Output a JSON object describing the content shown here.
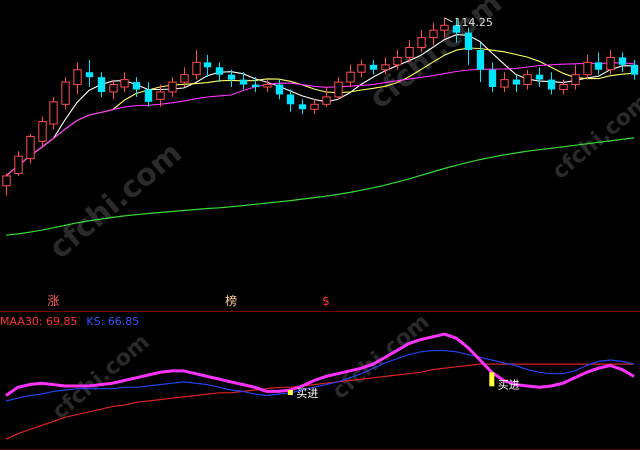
{
  "chart_data": [
    {
      "type": "candlestick",
      "title": "",
      "price_label": "114.25",
      "ylim": [
        20,
        118
      ],
      "colors": {
        "up": "#ff4d4d",
        "down": "#00e5ff",
        "ma_short": "#ffffff",
        "ma_mid": "#ffff66",
        "ma_long": "#ff33ff",
        "ma_xlong": "#33dd33"
      },
      "candles": [
        [
          46,
          50,
          42,
          51
        ],
        [
          51,
          58,
          50,
          60
        ],
        [
          57,
          66,
          55,
          67
        ],
        [
          64,
          72,
          62,
          74
        ],
        [
          71,
          80,
          69,
          82
        ],
        [
          79,
          88,
          77,
          90
        ],
        [
          87,
          93,
          83,
          96
        ],
        [
          92,
          90,
          86,
          97
        ],
        [
          90,
          84,
          82,
          92
        ],
        [
          84,
          87,
          81,
          89
        ],
        [
          86,
          89,
          84,
          92
        ],
        [
          88,
          85,
          82,
          90
        ],
        [
          85,
          80,
          78,
          88
        ],
        [
          81,
          84,
          78,
          87
        ],
        [
          84,
          88,
          82,
          90
        ],
        [
          88,
          91,
          86,
          94
        ],
        [
          91,
          96,
          89,
          101
        ],
        [
          96,
          94,
          90,
          99
        ],
        [
          94,
          91,
          88,
          96
        ],
        [
          91,
          89,
          86,
          93
        ],
        [
          89,
          87,
          85,
          92
        ],
        [
          87,
          86,
          84,
          90
        ],
        [
          86,
          87,
          84,
          89
        ],
        [
          87,
          83,
          81,
          89
        ],
        [
          83,
          79,
          76,
          85
        ],
        [
          79,
          77,
          75,
          81
        ],
        [
          77,
          79,
          75,
          81
        ],
        [
          79,
          82,
          78,
          86
        ],
        [
          82,
          88,
          81,
          90
        ],
        [
          88,
          92,
          86,
          95
        ],
        [
          92,
          95,
          90,
          97
        ],
        [
          95,
          93,
          91,
          97
        ],
        [
          93,
          95,
          91,
          98
        ],
        [
          95,
          98,
          93,
          101
        ],
        [
          98,
          102,
          96,
          105
        ],
        [
          102,
          106,
          100,
          109
        ],
        [
          106,
          109,
          103,
          112
        ],
        [
          109,
          111,
          106,
          114
        ],
        [
          111,
          108,
          104,
          114
        ],
        [
          108,
          101,
          95,
          110
        ],
        [
          101,
          93,
          88,
          104
        ],
        [
          93,
          86,
          84,
          96
        ],
        [
          86,
          89,
          84,
          92
        ],
        [
          89,
          87,
          84,
          91
        ],
        [
          87,
          91,
          85,
          93
        ],
        [
          91,
          89,
          86,
          94
        ],
        [
          89,
          85,
          83,
          92
        ],
        [
          85,
          87,
          83,
          89
        ],
        [
          87,
          91,
          85,
          95
        ],
        [
          91,
          96,
          89,
          99
        ],
        [
          96,
          93,
          91,
          100
        ],
        [
          93,
          98,
          91,
          101
        ],
        [
          98,
          95,
          92,
          100
        ],
        [
          95,
          91,
          89,
          97
        ]
      ],
      "sma": [
        {
          "name": "MA5",
          "period": 5,
          "color": "#ffffff"
        },
        {
          "name": "MA10",
          "period": 10,
          "color": "#ffff66"
        },
        {
          "name": "MA20",
          "period": 20,
          "color": "#ff33ff"
        }
      ],
      "long_ma": [
        26.0,
        26.5,
        27.2,
        28.0,
        29.0,
        30.0,
        31.0,
        31.8,
        32.5,
        33.2,
        33.8,
        34.3,
        34.8,
        35.2,
        35.6,
        36.0,
        36.4,
        36.8,
        37.1,
        37.5,
        38.0,
        38.5,
        39.0,
        39.5,
        40.0,
        40.6,
        41.2,
        41.8,
        42.5,
        43.3,
        44.2,
        45.2,
        46.3,
        47.5,
        48.8,
        50.2,
        51.6,
        53.0,
        54.3,
        55.5,
        56.6,
        57.6,
        58.5,
        59.3,
        60.0,
        60.6,
        61.2,
        61.8,
        62.4,
        63.0,
        63.6,
        64.2,
        64.8,
        65.4
      ],
      "markers": [
        {
          "index": 4,
          "text": "涨",
          "color": "#ff6666"
        },
        {
          "index": 19,
          "text": "榜",
          "color": "#ffcc99"
        },
        {
          "index": 27,
          "text": "$",
          "color": "#ff3333"
        }
      ]
    },
    {
      "type": "line",
      "legend": [
        {
          "text": "MAA30: 69.85",
          "color": "#ff3333"
        },
        {
          "text": "KS: 66.85",
          "color": "#3355ff"
        }
      ],
      "ylim": [
        25,
        110
      ],
      "series": [
        {
          "name": "MAA30",
          "color": "#dd2222",
          "values": [
            30,
            34,
            37,
            40,
            43,
            46,
            48,
            50,
            52,
            54,
            55,
            57,
            58,
            59,
            60,
            61,
            62,
            63,
            64,
            64,
            65,
            66,
            67,
            68,
            68,
            69,
            70,
            71,
            72,
            73,
            74,
            75,
            76,
            77,
            78,
            79,
            81,
            82,
            83,
            84,
            85,
            85,
            85,
            85,
            85,
            85,
            85,
            85,
            85,
            85,
            85,
            85,
            85,
            85
          ]
        },
        {
          "name": "KS",
          "color": "#2244ee",
          "values": [
            58,
            60,
            62,
            63,
            65,
            66,
            67,
            67,
            67,
            67,
            68,
            68,
            69,
            70,
            71,
            72,
            71,
            70,
            68,
            66,
            65,
            63,
            62,
            63,
            64,
            66,
            68,
            70,
            72,
            75,
            78,
            82,
            86,
            89,
            92,
            94,
            95,
            95,
            94,
            92,
            90,
            88,
            86,
            84,
            81,
            79,
            78,
            78,
            80,
            84,
            87,
            88,
            87,
            85
          ]
        },
        {
          "name": "",
          "color": "#ff33ff",
          "values": [
            62,
            68,
            70,
            71,
            70,
            69,
            69,
            69,
            70,
            71,
            73,
            75,
            77,
            79,
            80,
            80,
            78,
            76,
            74,
            72,
            70,
            68,
            65,
            65,
            66,
            69,
            73,
            76,
            78,
            80,
            82,
            85,
            90,
            95,
            100,
            103,
            105,
            107,
            104,
            97,
            88,
            79,
            73,
            70,
            69,
            68,
            69,
            71,
            75,
            79,
            82,
            84,
            81,
            76
          ]
        }
      ],
      "buy_signals": [
        {
          "index": 24,
          "text": "买进",
          "color": "#ffff33"
        },
        {
          "index": 41,
          "text": "买进",
          "color": "#ffff33"
        }
      ]
    }
  ],
  "watermark": "cfchi.com"
}
